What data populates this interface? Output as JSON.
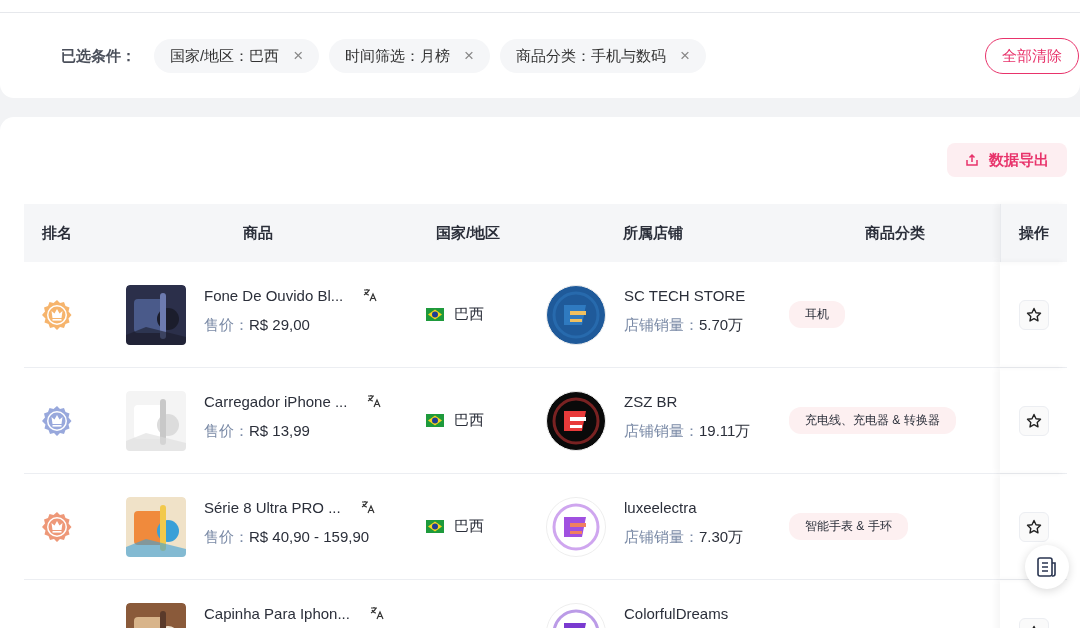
{
  "filter_bar": {
    "label": "已选条件：",
    "chips": [
      {
        "text": "国家/地区：巴西",
        "close": "×"
      },
      {
        "text": "时间筛选：月榜",
        "close": "×"
      },
      {
        "text": "商品分类：手机与数码",
        "close": "×"
      }
    ],
    "clear_button": "全部清除"
  },
  "toolbar": {
    "export_button": "数据导出"
  },
  "table": {
    "columns": [
      "排名",
      "商品",
      "国家/地区",
      "所属店铺",
      "商品分类",
      "操作"
    ],
    "rows": [
      {
        "rank": {
          "kind": "medal",
          "color": "#f6b46c"
        },
        "product": {
          "name": "Fone De Ouvido Bl...",
          "price_label": "售价：",
          "price": "R$ 29,00"
        },
        "country": "巴西",
        "store": {
          "name": "SC TECH STORE",
          "sales_label": "店铺销量：",
          "sales": "5.70万"
        },
        "category": "耳机"
      },
      {
        "rank": {
          "kind": "medal",
          "color": "#98a8dc"
        },
        "product": {
          "name": "Carregador iPhone ...",
          "price_label": "售价：",
          "price": "R$ 13,99"
        },
        "country": "巴西",
        "store": {
          "name": "ZSZ BR",
          "sales_label": "店铺销量：",
          "sales": "19.11万"
        },
        "category": "充电线、充电器 & 转换器"
      },
      {
        "rank": {
          "kind": "medal",
          "color": "#ee9878"
        },
        "product": {
          "name": "Série 8 Ultra PRO ...",
          "price_label": "售价：",
          "price": "R$ 40,90 - 159,90"
        },
        "country": "巴西",
        "store": {
          "name": "luxeelectra",
          "sales_label": "店铺销量：",
          "sales": "7.30万"
        },
        "category": "智能手表 & 手环"
      },
      {
        "product": {
          "name": "Capinha Para Iphon..."
        },
        "store": {
          "name": "ColorfulDreams"
        }
      }
    ]
  }
}
